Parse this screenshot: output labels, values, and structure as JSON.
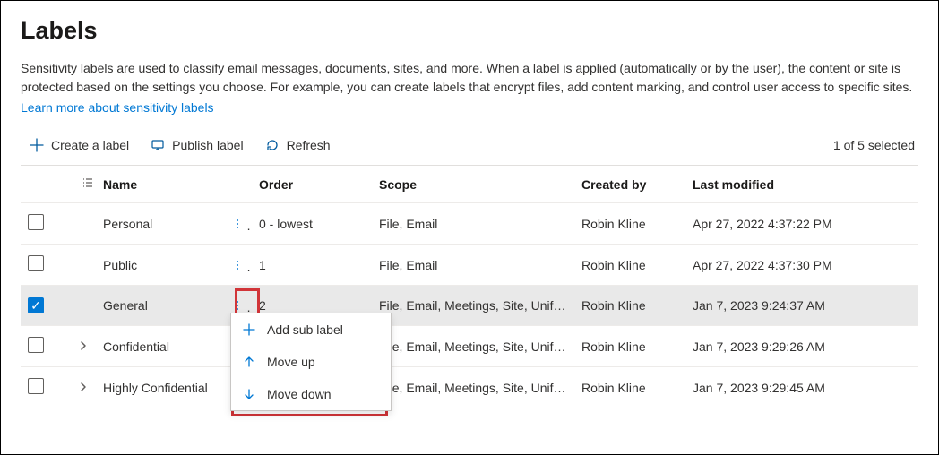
{
  "header": {
    "title": "Labels",
    "description": "Sensitivity labels are used to classify email messages, documents, sites, and more. When a label is applied (automatically or by the user), the content or site is protected based on the settings you choose. For example, you can create labels that encrypt files, add content marking, and control user access to specific sites.",
    "learn_link": "Learn more about sensitivity labels"
  },
  "toolbar": {
    "create_label": "Create a label",
    "publish_label": "Publish label",
    "refresh": "Refresh",
    "selection": "1 of 5 selected"
  },
  "columns": {
    "name": "Name",
    "order": "Order",
    "scope": "Scope",
    "created_by": "Created by",
    "last_modified": "Last modified"
  },
  "rows": [
    {
      "name": "Personal",
      "order": "0 - lowest",
      "scope": "File, Email",
      "created_by": "Robin Kline",
      "last_modified": "Apr 27, 2022 4:37:22 PM",
      "expandable": false,
      "selected": false
    },
    {
      "name": "Public",
      "order": "1",
      "scope": "File, Email",
      "created_by": "Robin Kline",
      "last_modified": "Apr 27, 2022 4:37:30 PM",
      "expandable": false,
      "selected": false
    },
    {
      "name": "General",
      "order": "2",
      "scope": "File, Email, Meetings, Site, UnifiedGroup",
      "created_by": "Robin Kline",
      "last_modified": "Jan 7, 2023 9:24:37 AM",
      "expandable": false,
      "selected": true
    },
    {
      "name": "Confidential",
      "order": "",
      "scope": "File, Email, Meetings, Site, UnifiedGroup",
      "created_by": "Robin Kline",
      "last_modified": "Jan 7, 2023 9:29:26 AM",
      "expandable": true,
      "selected": false
    },
    {
      "name": "Highly Confidential",
      "order": "",
      "scope": "File, Email, Meetings, Site, UnifiedGroup",
      "created_by": "Robin Kline",
      "last_modified": "Jan 7, 2023 9:29:45 AM",
      "expandable": true,
      "selected": false
    }
  ],
  "context_menu": {
    "add_sub_label": "Add sub label",
    "move_up": "Move up",
    "move_down": "Move down"
  }
}
